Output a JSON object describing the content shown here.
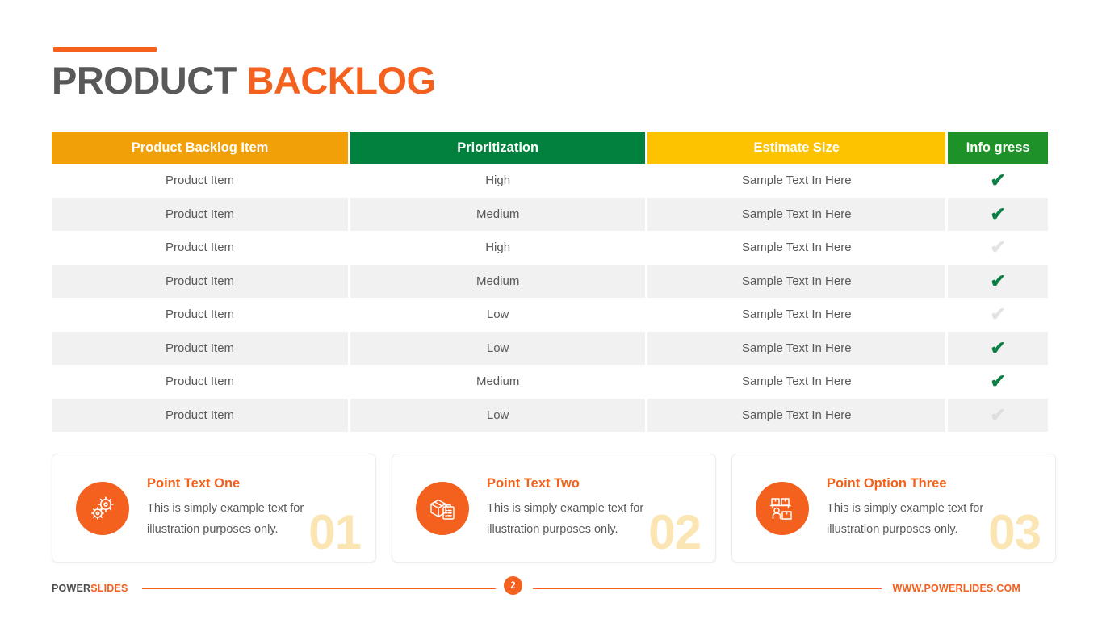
{
  "title": {
    "part1": "PRODUCT ",
    "part2": "BACKLOG"
  },
  "table": {
    "headers": [
      {
        "label": "Product Backlog Item",
        "color": "#F2A007"
      },
      {
        "label": "Prioritization",
        "color": "#00813D"
      },
      {
        "label": "Estimate Size",
        "color": "#FEC300"
      },
      {
        "label": "Info  gress",
        "color": "#1E9129"
      }
    ],
    "rows": [
      {
        "item": "Product Item",
        "priority": "High",
        "estimate": "Sample Text In Here",
        "status": "check-on",
        "check": "✔"
      },
      {
        "item": "Product Item",
        "priority": "Medium",
        "estimate": "Sample Text In Here",
        "status": "check-on",
        "check": "✔"
      },
      {
        "item": "Product Item",
        "priority": "High",
        "estimate": "Sample Text In Here",
        "status": "check-off",
        "check": "✔"
      },
      {
        "item": "Product Item",
        "priority": "Medium",
        "estimate": "Sample Text In Here",
        "status": "check-on",
        "check": "✔"
      },
      {
        "item": "Product Item",
        "priority": "Low",
        "estimate": "Sample Text In Here",
        "status": "check-off",
        "check": "✔"
      },
      {
        "item": "Product Item",
        "priority": "Low",
        "estimate": "Sample Text In Here",
        "status": "check-on",
        "check": "✔"
      },
      {
        "item": "Product Item",
        "priority": "Medium",
        "estimate": "Sample Text In Here",
        "status": "check-on",
        "check": "✔"
      },
      {
        "item": "Product Item",
        "priority": "Low",
        "estimate": "Sample Text In Here",
        "status": "check-off",
        "check": "✔"
      }
    ]
  },
  "cards": [
    {
      "icon": "gears-icon",
      "title": "Point Text One",
      "text": "This is simply example text for illustration purposes only.",
      "number": "01"
    },
    {
      "icon": "package-clipboard-icon",
      "title": "Point Text Two",
      "text": "This is simply example text for illustration purposes only.",
      "number": "02"
    },
    {
      "icon": "warehouse-shelf-icon",
      "title": "Point Option Three",
      "text": "This is simply example text for illustration purposes only.",
      "number": "03"
    }
  ],
  "footer": {
    "brand_part1": "POWER",
    "brand_part2": "SLIDES",
    "page_number": "2",
    "url": "WWW.POWERLIDES.COM"
  },
  "colors": {
    "accent_orange": "#F4601E",
    "title_gray": "#595959",
    "header_orange": "#F2A007",
    "header_green": "#00813D",
    "header_yellow": "#FEC300",
    "header_green2": "#1E9129",
    "check_green": "#0C8044",
    "check_gray": "#E3E3E3",
    "row_alt": "#F1F1F1",
    "number_cream": "#FBE5B2"
  }
}
